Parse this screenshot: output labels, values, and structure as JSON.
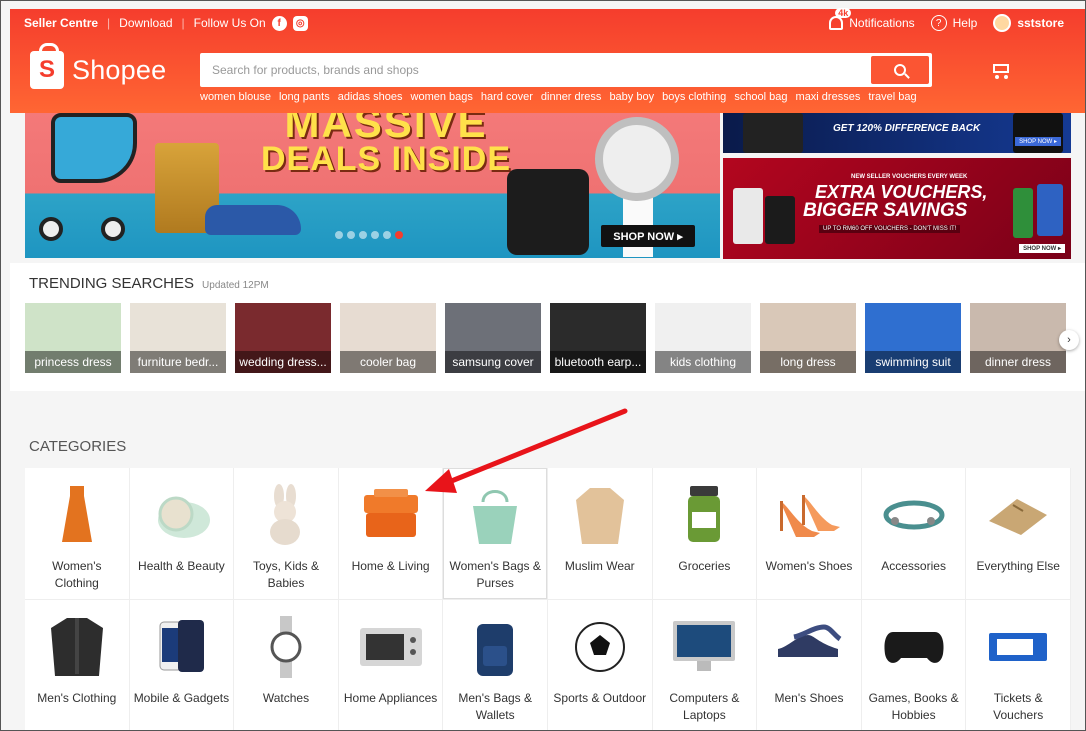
{
  "topbar": {
    "seller_centre": "Seller Centre",
    "download": "Download",
    "follow_us": "Follow Us On",
    "notif_badge": "4k",
    "notifications": "Notifications",
    "help": "Help",
    "username": "sststore"
  },
  "header": {
    "logo_text": "Shopee",
    "search_placeholder": "Search for products, brands and shops",
    "keywords": [
      "women blouse",
      "long pants",
      "adidas shoes",
      "women bags",
      "hard cover",
      "dinner dress",
      "baby boy",
      "boys clothing",
      "school bag",
      "maxi dresses",
      "travel bag"
    ]
  },
  "banner": {
    "main_line1": "MASSIVE",
    "main_line2": "DEALS INSIDE",
    "shop_now": "SHOP NOW ▸",
    "side1_text": "GET 120% DIFFERENCE BACK",
    "side1_btn": "SHOP NOW ▸",
    "side2_small": "NEW SELLER VOUCHERS EVERY WEEK",
    "side2_big1": "EXTRA VOUCHERS,",
    "side2_big2": "BIGGER SAVINGS",
    "side2_sub": "UP TO RM60 OFF VOUCHERS - DON'T MISS IT!",
    "side2_btn": "SHOP NOW ▸"
  },
  "trending": {
    "title": "TRENDING SEARCHES",
    "updated": "Updated 12PM",
    "tiles": [
      {
        "label": "princess dress",
        "color": "#cfe3c8"
      },
      {
        "label": "furniture bedr...",
        "color": "#e8e2d8"
      },
      {
        "label": "wedding dress...",
        "color": "#7a2a2e"
      },
      {
        "label": "cooler bag",
        "color": "#e7dcd2"
      },
      {
        "label": "samsung cover",
        "color": "#6d7078"
      },
      {
        "label": "bluetooth earp...",
        "color": "#2b2b2b"
      },
      {
        "label": "kids clothing",
        "color": "#f0f0f0"
      },
      {
        "label": "long dress",
        "color": "#d9c8b8"
      },
      {
        "label": "swimming suit",
        "color": "#2f6fd0"
      },
      {
        "label": "dinner dress",
        "color": "#c9b9ad"
      }
    ]
  },
  "categories": {
    "title": "CATEGORIES",
    "items": [
      {
        "name": "Women's Clothing",
        "icon": "dress-icon"
      },
      {
        "name": "Health & Beauty",
        "icon": "compact-powder-icon"
      },
      {
        "name": "Toys, Kids & Babies",
        "icon": "plush-bunny-icon"
      },
      {
        "name": "Home & Living",
        "icon": "storage-box-icon"
      },
      {
        "name": "Women's Bags & Purses",
        "icon": "tote-bag-icon"
      },
      {
        "name": "Muslim Wear",
        "icon": "blouse-icon"
      },
      {
        "name": "Groceries",
        "icon": "jar-icon"
      },
      {
        "name": "Women's Shoes",
        "icon": "heels-icon"
      },
      {
        "name": "Accessories",
        "icon": "bracelet-icon"
      },
      {
        "name": "Everything Else",
        "icon": "gift-pouch-icon"
      },
      {
        "name": "Men's Clothing",
        "icon": "shirt-icon"
      },
      {
        "name": "Mobile & Gadgets",
        "icon": "phone-icon"
      },
      {
        "name": "Watches",
        "icon": "watch-icon"
      },
      {
        "name": "Home Appliances",
        "icon": "oven-icon"
      },
      {
        "name": "Men's Bags & Wallets",
        "icon": "backpack-icon"
      },
      {
        "name": "Sports & Outdoor",
        "icon": "soccer-ball-icon"
      },
      {
        "name": "Computers & Laptops",
        "icon": "monitor-icon"
      },
      {
        "name": "Men's Shoes",
        "icon": "dress-shoe-icon"
      },
      {
        "name": "Games, Books & Hobbies",
        "icon": "gamepad-icon"
      },
      {
        "name": "Tickets & Vouchers",
        "icon": "ticket-icon"
      }
    ]
  },
  "colors": {
    "brand": "#f53d2d",
    "annotation_arrow": "#e8141a"
  }
}
